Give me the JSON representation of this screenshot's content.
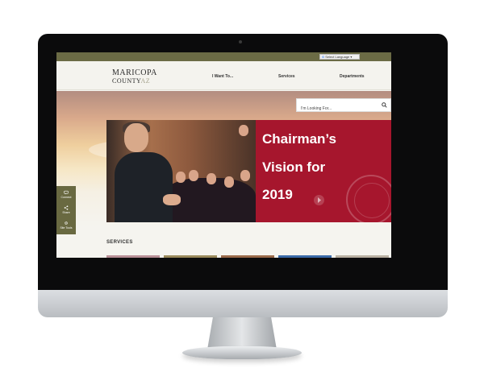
{
  "translate": {
    "label": "Select Language"
  },
  "logo": {
    "line1": "MARICOPA",
    "line2_main": "COUNTY",
    "line2_suffix": "AZ"
  },
  "nav": {
    "items": [
      "I Want To...",
      "Services",
      "Departments"
    ]
  },
  "search": {
    "placeholder": "I'm Looking For..."
  },
  "hero": {
    "headline": [
      "Chairman’s",
      "Vision for",
      "2019"
    ]
  },
  "side_tools": {
    "items": [
      "Connect",
      "Share",
      "Site Tools"
    ]
  },
  "services": {
    "title": "SERVICES"
  },
  "colors": {
    "topbar": "#6b6b45",
    "banner_red": "#a6162d",
    "side_tools": "#696941",
    "page_bg": "#f5f4ef"
  }
}
